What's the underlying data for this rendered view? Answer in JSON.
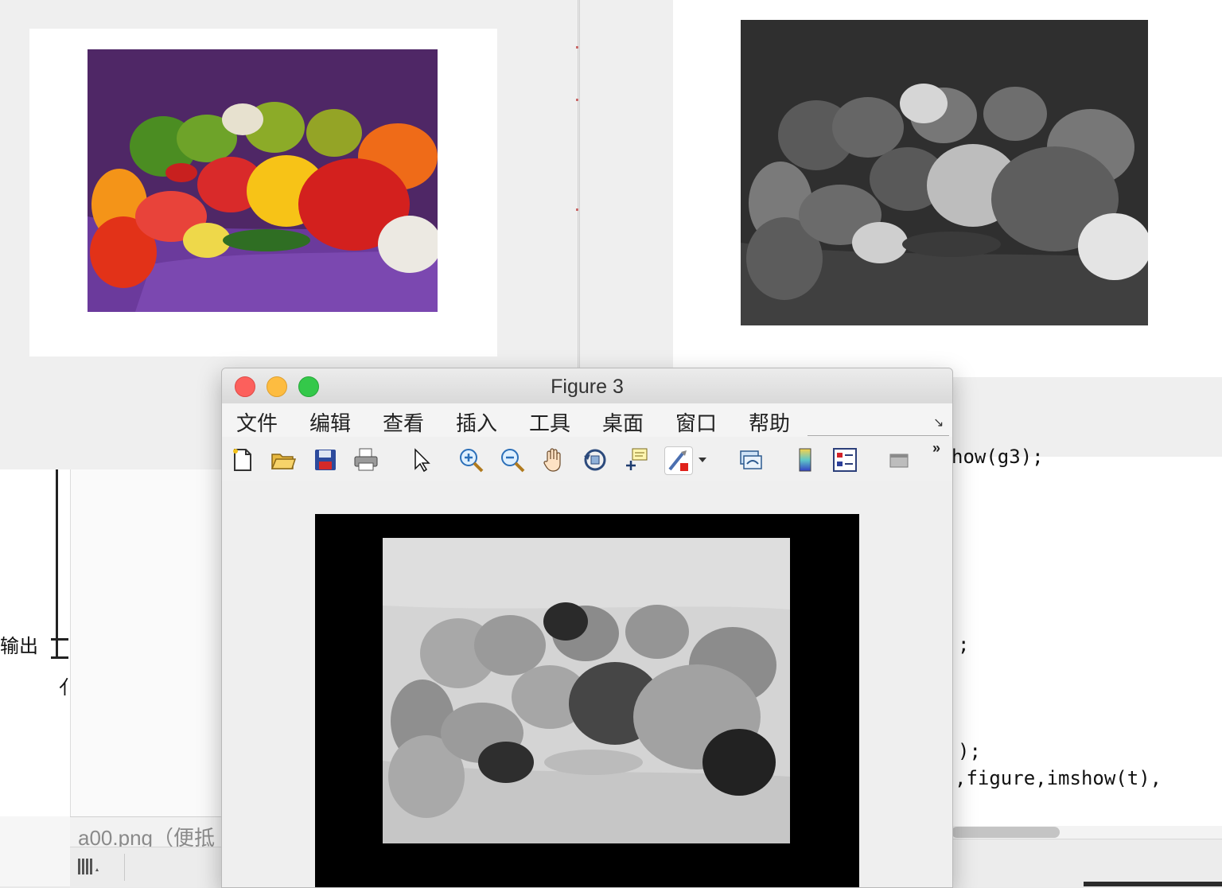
{
  "figure3": {
    "title": "Figure 3",
    "menus": [
      "文件",
      "编辑",
      "查看",
      "插入",
      "工具",
      "桌面",
      "窗口",
      "帮助"
    ],
    "overflow_label": "»"
  },
  "background_doc": {
    "side_text": "输出",
    "side_text2": "亻",
    "status_text": "a00.png（便抵"
  },
  "editor": {
    "lines": [
      "how(g3);",
      ";",
      ");",
      ",figure,imshow(t),"
    ]
  },
  "colors": {
    "close": "#fc605c",
    "minimize": "#fdbc40",
    "maximize": "#34c84a"
  }
}
